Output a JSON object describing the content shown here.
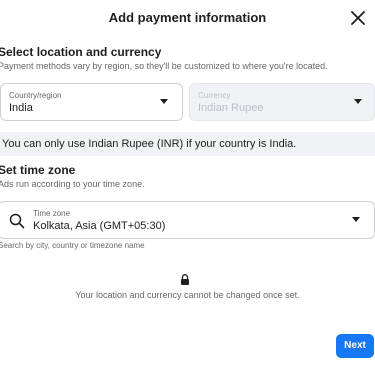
{
  "modal": {
    "title": "Add payment information"
  },
  "location_section": {
    "title": "Select location and currency",
    "subtitle": "Payment methods vary by region, so they'll be customized to where you're located."
  },
  "country_field": {
    "label": "Country/region",
    "value": "India"
  },
  "currency_field": {
    "label": "Currency",
    "value": "Indian Rupee"
  },
  "notice": {
    "text": "You can only use Indian Rupee (INR) if your country is India."
  },
  "timezone_section": {
    "title": "Set time zone",
    "subtitle": "Ads run according to your time zone."
  },
  "timezone_field": {
    "label": "Time zone",
    "value": "Kolkata, Asia (GMT+05:30)"
  },
  "timezone_hint": "Search by city, country or timezone name",
  "lock_note": "Your location and currency cannot be changed once set.",
  "footer": {
    "next_label": "Next"
  },
  "colors": {
    "primary": "#1877f2",
    "notice_bg": "#f0f2f5",
    "muted_text": "#65676b"
  }
}
